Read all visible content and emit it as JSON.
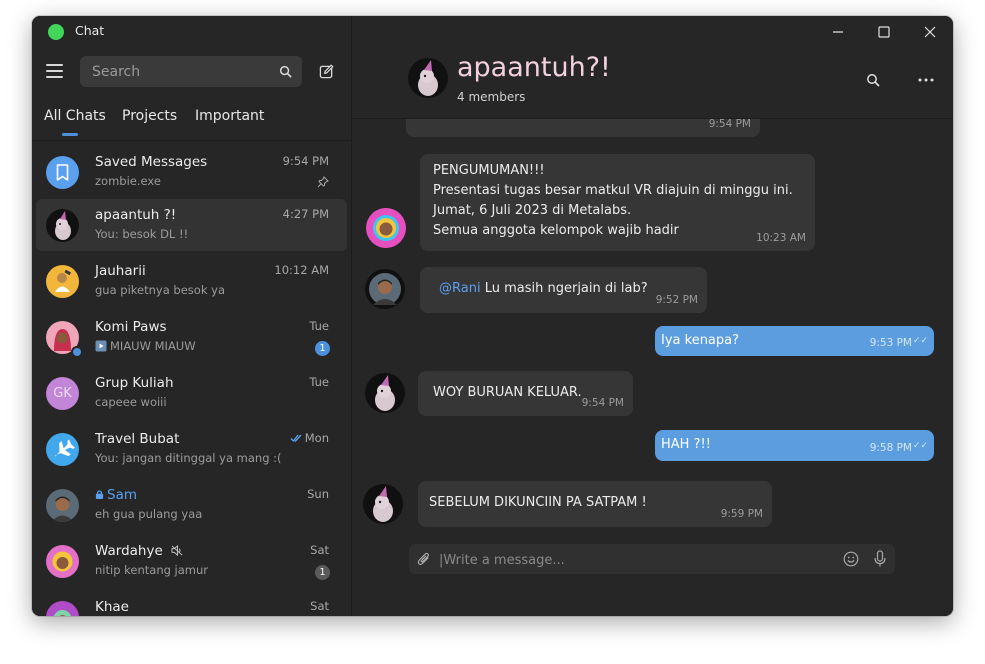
{
  "app": {
    "title": "Chat"
  },
  "sidebar": {
    "search_placeholder": "Search",
    "tabs": [
      {
        "label": "All Chats"
      },
      {
        "label": "Projects"
      },
      {
        "label": "Important"
      }
    ],
    "chats": [
      {
        "name": "Saved Messages",
        "preview": "zombie.exe",
        "time": "9:54 PM"
      },
      {
        "name": "apaantuh ?!",
        "preview": "You: besok DL !!",
        "time": "4:27 PM"
      },
      {
        "name": "Jauharii",
        "preview": "gua piketnya besok ya",
        "time": "10:12 AM"
      },
      {
        "name": "Komi Paws",
        "preview": "MIAUW MIAUW",
        "time": "Tue",
        "badge": "1"
      },
      {
        "name": "Grup Kuliah",
        "preview": "capeee woiii",
        "time": "Tue",
        "initials": "GK"
      },
      {
        "name": "Travel Bubat",
        "preview": "You: jangan ditinggal ya mang :(",
        "time": "Mon"
      },
      {
        "name": "Sam",
        "preview": "eh gua pulang yaa",
        "time": "Sun"
      },
      {
        "name": "Wardahye",
        "preview": "nitip kentang jamur",
        "time": "Sat",
        "badge": "1"
      },
      {
        "name": "Khae",
        "preview": "",
        "time": "Sat"
      }
    ]
  },
  "conversation": {
    "title": "apaantuh?!",
    "subtitle": "4 members",
    "messages": [
      {
        "time": "9:54 PM"
      },
      {
        "lines": [
          "PENGUMUMAN!!!",
          "Presentasi tugas besar matkul VR diajuin di minggu ini.",
          "Jumat, 6 Juli 2023 di Metalabs.",
          "Semua anggota kelompok wajib hadir"
        ],
        "time": "10:23 AM"
      },
      {
        "mention": "@Rani",
        "text": "Lu masih ngerjain di lab?",
        "time": "9:52 PM"
      },
      {
        "text": "Iya kenapa?",
        "time": "9:53 PM"
      },
      {
        "text": "WOY BURUAN KELUAR.",
        "time": "9:54 PM"
      },
      {
        "text": "HAH ?!!",
        "time": "9:58 PM"
      },
      {
        "text": "SEBELUM DIKUNCIIN PA SATPAM !",
        "time": "9:59 PM"
      }
    ],
    "composer_placeholder": "|Write a message..."
  },
  "colors": {
    "accent": "#4c90de",
    "outgoing_bubble": "#5b9ddf",
    "window_bg": "#262626",
    "app_dot": "#41d65a"
  }
}
